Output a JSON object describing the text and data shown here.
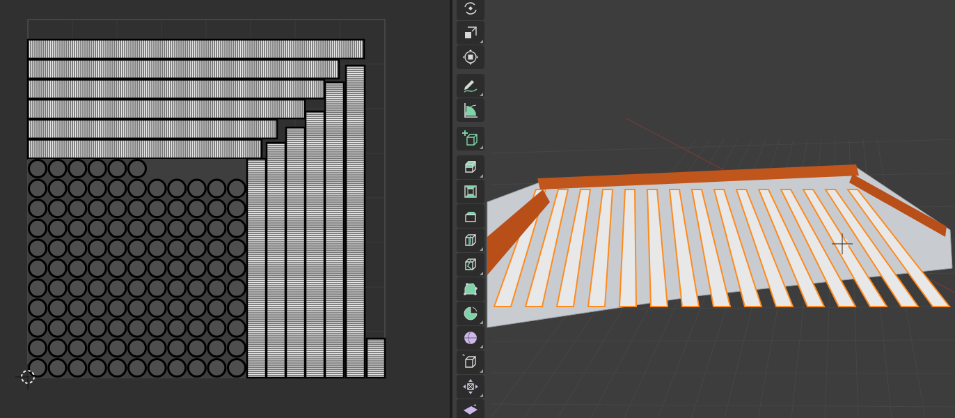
{
  "toolbar": {
    "groups": [
      {
        "tools": [
          {
            "kind": "rotate",
            "more": false
          },
          {
            "kind": "scale",
            "more": true
          },
          {
            "kind": "transform",
            "more": false
          }
        ]
      },
      {
        "tools": [
          {
            "kind": "annotate",
            "more": true
          },
          {
            "kind": "measure",
            "more": false
          }
        ]
      },
      {
        "tools": [
          {
            "kind": "add-cube",
            "more": true
          }
        ]
      },
      {
        "tools": [
          {
            "kind": "extrude",
            "more": true
          },
          {
            "kind": "inset",
            "more": false
          },
          {
            "kind": "bevel",
            "more": false
          },
          {
            "kind": "loop-cut",
            "more": true
          },
          {
            "kind": "knife",
            "more": true
          },
          {
            "kind": "poly-build",
            "more": false
          },
          {
            "kind": "spin",
            "more": true
          },
          {
            "kind": "smooth",
            "more": true
          },
          {
            "kind": "edge-slide",
            "more": true
          },
          {
            "kind": "shrink",
            "more": true
          },
          {
            "kind": "shear"
          }
        ]
      }
    ]
  }
}
